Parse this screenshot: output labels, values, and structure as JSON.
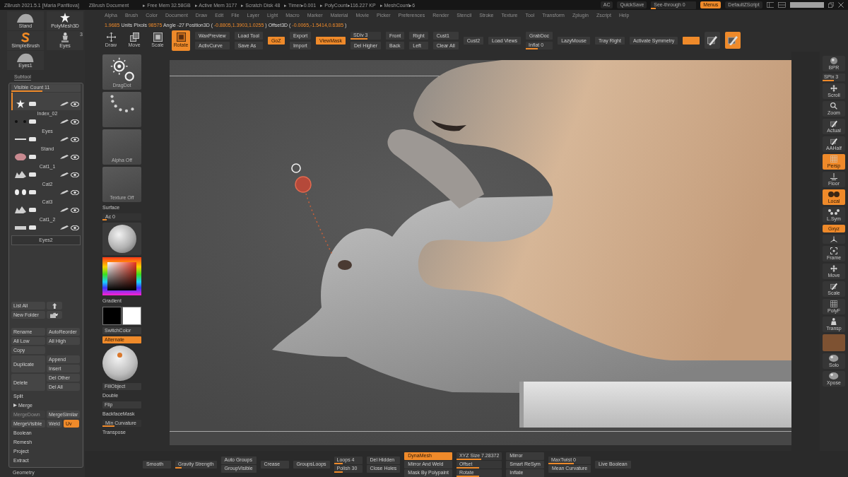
{
  "title_bar": {
    "app": "ZBrush 2021.5.1 [Maria Panfilova]",
    "document": "ZBrush Document",
    "stats": [
      "▸ Free Mem 32.58GB",
      "▸ Active Mem 3177",
      "▸ Scratch Disk 48",
      "▸ Timer▸0.001",
      "▸ PolyCount▸116.227 KP",
      "▸ MeshCount▸6"
    ],
    "ac": "AC",
    "quicksave": "QuickSave",
    "see_through": {
      "label": "See-through 0",
      "level": 0.1
    },
    "menus": {
      "label": "Menus",
      "on": true
    },
    "script": "DefaultZScript"
  },
  "menu_bar": [
    "Alpha",
    "Brush",
    "Color",
    "Document",
    "Draw",
    "Edit",
    "File",
    "Layer",
    "Light",
    "Macro",
    "Marker",
    "Material",
    "Movie",
    "Picker",
    "Preferences",
    "Render",
    "Stencil",
    "Stroke",
    "Texture",
    "Tool",
    "Transform",
    "Zplugin",
    "Zscript",
    "Help"
  ],
  "info_bar": [
    {
      "kind": "value",
      "text": "1.9685"
    },
    {
      "kind": "label",
      "text": "Units"
    },
    {
      "kind": "label",
      "text": "Pixols"
    },
    {
      "kind": "value",
      "text": "98575"
    },
    {
      "kind": "label",
      "text": "Angle -27 Position3D ("
    },
    {
      "kind": "value",
      "text": "-0.8805,1.3903,1.0255"
    },
    {
      "kind": "label",
      "text": ") Offset3D ("
    },
    {
      "kind": "value",
      "text": "-0.0065,-1.5414,0.6385"
    },
    {
      "kind": "label",
      "text": ")"
    }
  ],
  "tools": [
    {
      "label": "Draw",
      "selected": false
    },
    {
      "label": "Move",
      "selected": false
    },
    {
      "label": "Scale",
      "selected": false
    },
    {
      "label": "Rotate",
      "selected": true
    }
  ],
  "toolbar": [
    [
      {
        "kind": "button",
        "label": "WaxPreview",
        "on": false
      },
      {
        "kind": "button",
        "label": "ActivCurve",
        "on": false
      }
    ],
    [
      {
        "kind": "button",
        "label": "Load Tool",
        "on": false
      },
      {
        "kind": "button",
        "label": "Save As",
        "on": false
      }
    ],
    [
      {
        "kind": "button",
        "label": "GoZ",
        "on": true
      }
    ],
    [
      {
        "kind": "button",
        "label": "Export",
        "on": false
      },
      {
        "kind": "button",
        "label": "Import",
        "on": false
      }
    ],
    [
      {
        "kind": "button",
        "label": "ViewMask",
        "on": true
      }
    ],
    [
      {
        "kind": "slider",
        "label": "SDiv 3",
        "level": 0.55
      },
      {
        "kind": "button",
        "label": "Del Higher",
        "on": false
      }
    ],
    [
      {
        "kind": "button",
        "label": "Front",
        "on": false
      },
      {
        "kind": "button",
        "label": "Back",
        "on": false
      }
    ],
    [
      {
        "kind": "button",
        "label": "Right",
        "on": false
      },
      {
        "kind": "button",
        "label": "Left",
        "on": false
      }
    ],
    [
      {
        "kind": "button",
        "label": "Cust1",
        "on": false
      },
      {
        "kind": "button",
        "label": "Clear All",
        "on": false
      }
    ],
    [
      {
        "kind": "button",
        "label": "Cust2",
        "on": false
      }
    ],
    [
      {
        "kind": "button",
        "label": "Load Views",
        "on": false
      }
    ],
    [
      {
        "kind": "button",
        "label": "GrabDoc",
        "on": false
      },
      {
        "kind": "slider",
        "label": "Inflat 0",
        "level": 0.45
      }
    ],
    [
      {
        "kind": "button",
        "label": "LazyMouse",
        "on": false
      }
    ],
    [
      {
        "kind": "button",
        "label": "Tray Right",
        "on": false
      }
    ],
    [
      {
        "kind": "button",
        "label": "Activate Symmetry",
        "on": false
      }
    ],
    [
      {
        "kind": "button",
        "on": true
      }
    ],
    [
      {
        "kind": "mode",
        "on": false
      }
    ],
    [
      {
        "kind": "mode",
        "on": true
      }
    ]
  ],
  "tool_thumbs": [
    {
      "label": "Stand"
    },
    {
      "label": "PolyMesh3D"
    },
    {
      "label": "SimpleBrush"
    },
    {
      "label": "Eyes",
      "badge": "3"
    },
    {
      "label": "Eyes1"
    }
  ],
  "subtool": {
    "tab": "Subtool",
    "visible_count": {
      "label": "Visible Count 11",
      "level": 0.45
    },
    "slots": [
      {
        "selected": true,
        "visible": true
      },
      {
        "name": "Index_02",
        "selected": false,
        "visible": true
      },
      {
        "name": "Eyes",
        "selected": false,
        "visible": true
      },
      {
        "name": "Stand",
        "selected": false,
        "visible": true
      },
      {
        "name": "Cat1_1",
        "selected": false,
        "visible": true
      },
      {
        "name": "Cat2",
        "selected": false,
        "visible": true
      },
      {
        "name": "Cat3",
        "selected": false,
        "visible": true
      },
      {
        "name": "Cat1_2",
        "selected": false,
        "visible": true
      }
    ],
    "footer": "Eyes2"
  },
  "actions": [
    [
      {
        "kind": "button",
        "label": "List All",
        "on": false
      },
      {
        "kind": "icon",
        "on": false
      }
    ],
    [
      {
        "kind": "button",
        "label": "New Folder",
        "on": false
      },
      {
        "kind": "icon",
        "on": false
      }
    ],
    [
      {
        "kind": "button",
        "label": "Rename",
        "on": false
      },
      {
        "kind": "button",
        "label": "AutoReorder",
        "on": false
      }
    ],
    [
      {
        "kind": "button",
        "label": "All Low",
        "on": false
      },
      {
        "kind": "button",
        "label": "All High",
        "on": false
      }
    ],
    [
      {
        "kind": "button",
        "label": "Copy",
        "on": false
      }
    ],
    [
      {
        "kind": "tall",
        "label": "Duplicate",
        "on": false
      },
      {
        "kind": "stack",
        "items": [
          {
            "label": "Append",
            "on": false
          },
          {
            "label": "Insert",
            "on": false
          }
        ]
      }
    ],
    [
      {
        "kind": "tall",
        "label": "Delete",
        "on": false
      },
      {
        "kind": "stack",
        "items": [
          {
            "label": "Del Other",
            "on": false
          },
          {
            "label": "Del All",
            "on": false
          }
        ]
      }
    ],
    [
      {
        "kind": "header",
        "label": "Split",
        "expanded": false
      }
    ],
    [
      {
        "kind": "header",
        "label": "Merge",
        "expanded": true
      }
    ],
    [
      {
        "kind": "button",
        "label": "MergeDown",
        "on": false,
        "disabled": true
      },
      {
        "kind": "button",
        "label": "MergeSimilar",
        "on": false
      }
    ],
    [
      {
        "kind": "button",
        "label": "MergeVisible",
        "on": false
      },
      {
        "kind": "small",
        "label": "Weld",
        "on": false
      },
      {
        "kind": "small",
        "label": "Uv",
        "on": true
      }
    ],
    [
      {
        "kind": "header",
        "label": "Boolean",
        "expanded": false
      }
    ],
    [
      {
        "kind": "header",
        "label": "Remesh",
        "expanded": false
      }
    ],
    [
      {
        "kind": "header",
        "label": "Project",
        "expanded": false
      }
    ],
    [
      {
        "kind": "header",
        "label": "Extract",
        "expanded": false
      }
    ]
  ],
  "geometry": "Geometry",
  "shelf": [
    {
      "kind": "thumb",
      "label": "DragDot"
    },
    {
      "kind": "thumb"
    },
    {
      "kind": "thumb",
      "label": "Alpha Off"
    },
    {
      "kind": "thumb",
      "label": "Texture Off"
    },
    {
      "kind": "label",
      "label": "Surface"
    },
    {
      "kind": "slider",
      "label": "Ac 0",
      "level": 0.1
    },
    {
      "kind": "material"
    },
    {
      "kind": "picker"
    },
    {
      "kind": "label",
      "label": "Gradient"
    },
    {
      "kind": "swatches",
      "swatches": [
        {
          "color": "#000000"
        },
        {
          "color": "#ffffff"
        }
      ]
    },
    {
      "kind": "button",
      "label": "SwitchColor",
      "on": false
    },
    {
      "kind": "button",
      "label": "Alternate",
      "on": true
    },
    {
      "kind": "sphere"
    },
    {
      "kind": "button",
      "label": "FillObject",
      "on": false
    },
    {
      "kind": "label",
      "label": "Double"
    },
    {
      "kind": "button",
      "label": "Flip",
      "on": false
    },
    {
      "kind": "label",
      "label": "BackfaceMask"
    },
    {
      "kind": "slider",
      "label": "Min Curvature",
      "level": 0.3
    },
    {
      "kind": "label",
      "label": "Transpose"
    }
  ],
  "right_shelf": [
    {
      "kind": "tool",
      "label": "BPR",
      "on": false
    },
    {
      "kind": "slider",
      "label": "SPix 3",
      "level": 0.5
    },
    {
      "kind": "tool",
      "label": "Scroll",
      "on": false
    },
    {
      "kind": "tool",
      "label": "Zoom",
      "on": false
    },
    {
      "kind": "tool",
      "label": "Actual",
      "on": false
    },
    {
      "kind": "tool",
      "label": "AAHalf",
      "on": false
    },
    {
      "kind": "tool",
      "label": "Persp",
      "on": true
    },
    {
      "kind": "tool",
      "label": "Floor",
      "on": false
    },
    {
      "kind": "tool",
      "label": "Local",
      "on": true
    },
    {
      "kind": "tool",
      "label": "L.Sym",
      "on": false
    },
    {
      "kind": "tool",
      "label": "Gxyz",
      "on": true
    },
    {
      "kind": "tool",
      "on": false
    },
    {
      "kind": "tool",
      "label": "Frame",
      "on": false
    },
    {
      "kind": "tool",
      "label": "Move",
      "on": false
    },
    {
      "kind": "tool",
      "label": "Scale",
      "on": false
    },
    {
      "kind": "tool",
      "label": "PolyF",
      "on": false
    },
    {
      "kind": "tool",
      "label": "Transp",
      "on": false
    },
    {
      "kind": "tile",
      "on": true
    },
    {
      "kind": "tool",
      "label": "Solo",
      "on": false
    },
    {
      "kind": "tool",
      "label": "Xpose",
      "on": false
    }
  ],
  "bottom_bar": [
    [
      {
        "kind": "button",
        "label": "Smooth",
        "on": false
      }
    ],
    [
      {
        "kind": "slider",
        "label": "Gravity Strength",
        "level": 0.15
      }
    ],
    [
      {
        "kind": "button",
        "label": "Auto Groups",
        "on": false
      },
      {
        "kind": "button",
        "label": "GroupVisible",
        "on": false
      }
    ],
    [
      {
        "kind": "button",
        "label": "Crease",
        "on": false
      }
    ],
    [
      {
        "kind": "button",
        "label": "GroupsLoops",
        "on": false
      }
    ],
    [
      {
        "kind": "slider",
        "label": "Loops 4",
        "level": 0.3
      },
      {
        "kind": "slider",
        "label": "Polish 30",
        "level": 0.3
      }
    ],
    [
      {
        "kind": "button",
        "label": "Del Hidden",
        "on": false
      },
      {
        "kind": "button",
        "label": "Close Holes",
        "on": false
      }
    ],
    [
      {
        "kind": "button",
        "label": "DynaMesh",
        "on": true
      },
      {
        "kind": "button",
        "label": "Mirror And Weld",
        "on": false
      },
      {
        "kind": "button",
        "label": "Mask By Polypaint",
        "on": false
      }
    ],
    [
      {
        "kind": "slider",
        "label": "XYZ Size 7.28372",
        "level": 0.55
      },
      {
        "kind": "slider",
        "label": "Offset",
        "level": 0.5
      },
      {
        "kind": "slider",
        "label": "Rotate",
        "level": 0.5
      }
    ],
    [
      {
        "kind": "button",
        "label": "Mirror",
        "on": false
      },
      {
        "kind": "button",
        "label": "Smart ReSym",
        "on": false
      },
      {
        "kind": "button",
        "label": "Inflate",
        "on": false
      }
    ],
    [
      {
        "kind": "slider",
        "label": "MaxTwist 0",
        "level": 0.6
      },
      {
        "kind": "button",
        "label": "Mean Curvature",
        "on": false
      }
    ],
    [
      {
        "kind": "button",
        "label": "Live Boolean",
        "on": false
      }
    ]
  ]
}
